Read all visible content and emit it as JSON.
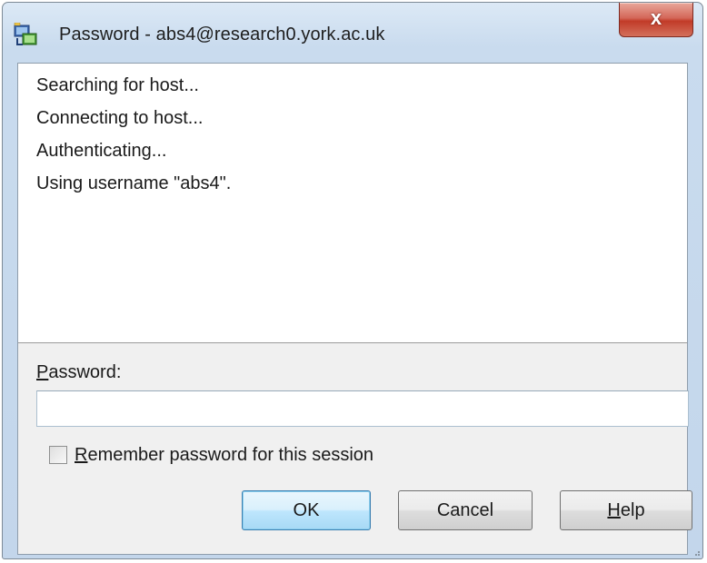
{
  "window": {
    "title": "Password - abs4@research0.york.ac.uk",
    "close_label": "x"
  },
  "log": {
    "lines": [
      "Searching for host...",
      "Connecting to host...",
      "Authenticating...",
      "Using username \"abs4\"."
    ]
  },
  "password": {
    "label_mnemonic": "P",
    "label_rest": "assword:",
    "value": ""
  },
  "remember": {
    "checked": false,
    "label_mnemonic": "R",
    "label_rest": "emember password for this session"
  },
  "buttons": {
    "ok": "OK",
    "cancel": "Cancel",
    "help_mnemonic": "H",
    "help_rest": "elp"
  },
  "colors": {
    "frame": "#c3d6eb",
    "close": "#c23b28",
    "default_button": "#bee6fd"
  }
}
